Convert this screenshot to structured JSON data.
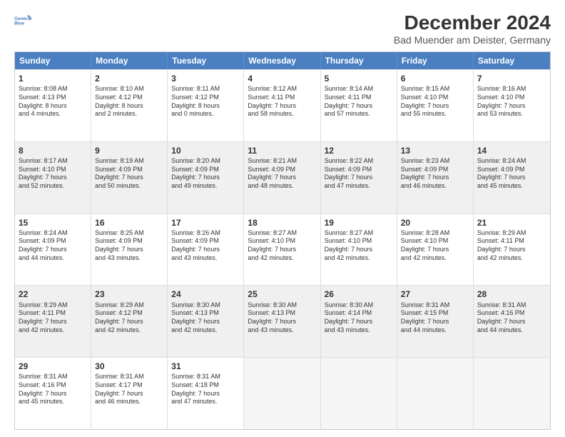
{
  "header": {
    "logo_line1": "General",
    "logo_line2": "Blue",
    "title": "December 2024",
    "subtitle": "Bad Muender am Deister, Germany"
  },
  "calendar": {
    "days": [
      "Sunday",
      "Monday",
      "Tuesday",
      "Wednesday",
      "Thursday",
      "Friday",
      "Saturday"
    ],
    "rows": [
      [
        {
          "day": "1",
          "lines": [
            "Sunrise: 8:08 AM",
            "Sunset: 4:13 PM",
            "Daylight: 8 hours",
            "and 4 minutes."
          ]
        },
        {
          "day": "2",
          "lines": [
            "Sunrise: 8:10 AM",
            "Sunset: 4:12 PM",
            "Daylight: 8 hours",
            "and 2 minutes."
          ]
        },
        {
          "day": "3",
          "lines": [
            "Sunrise: 8:11 AM",
            "Sunset: 4:12 PM",
            "Daylight: 8 hours",
            "and 0 minutes."
          ]
        },
        {
          "day": "4",
          "lines": [
            "Sunrise: 8:12 AM",
            "Sunset: 4:11 PM",
            "Daylight: 7 hours",
            "and 58 minutes."
          ]
        },
        {
          "day": "5",
          "lines": [
            "Sunrise: 8:14 AM",
            "Sunset: 4:11 PM",
            "Daylight: 7 hours",
            "and 57 minutes."
          ]
        },
        {
          "day": "6",
          "lines": [
            "Sunrise: 8:15 AM",
            "Sunset: 4:10 PM",
            "Daylight: 7 hours",
            "and 55 minutes."
          ]
        },
        {
          "day": "7",
          "lines": [
            "Sunrise: 8:16 AM",
            "Sunset: 4:10 PM",
            "Daylight: 7 hours",
            "and 53 minutes."
          ]
        }
      ],
      [
        {
          "day": "8",
          "lines": [
            "Sunrise: 8:17 AM",
            "Sunset: 4:10 PM",
            "Daylight: 7 hours",
            "and 52 minutes."
          ]
        },
        {
          "day": "9",
          "lines": [
            "Sunrise: 8:19 AM",
            "Sunset: 4:09 PM",
            "Daylight: 7 hours",
            "and 50 minutes."
          ]
        },
        {
          "day": "10",
          "lines": [
            "Sunrise: 8:20 AM",
            "Sunset: 4:09 PM",
            "Daylight: 7 hours",
            "and 49 minutes."
          ]
        },
        {
          "day": "11",
          "lines": [
            "Sunrise: 8:21 AM",
            "Sunset: 4:09 PM",
            "Daylight: 7 hours",
            "and 48 minutes."
          ]
        },
        {
          "day": "12",
          "lines": [
            "Sunrise: 8:22 AM",
            "Sunset: 4:09 PM",
            "Daylight: 7 hours",
            "and 47 minutes."
          ]
        },
        {
          "day": "13",
          "lines": [
            "Sunrise: 8:23 AM",
            "Sunset: 4:09 PM",
            "Daylight: 7 hours",
            "and 46 minutes."
          ]
        },
        {
          "day": "14",
          "lines": [
            "Sunrise: 8:24 AM",
            "Sunset: 4:09 PM",
            "Daylight: 7 hours",
            "and 45 minutes."
          ]
        }
      ],
      [
        {
          "day": "15",
          "lines": [
            "Sunrise: 8:24 AM",
            "Sunset: 4:09 PM",
            "Daylight: 7 hours",
            "and 44 minutes."
          ]
        },
        {
          "day": "16",
          "lines": [
            "Sunrise: 8:25 AM",
            "Sunset: 4:09 PM",
            "Daylight: 7 hours",
            "and 43 minutes."
          ]
        },
        {
          "day": "17",
          "lines": [
            "Sunrise: 8:26 AM",
            "Sunset: 4:09 PM",
            "Daylight: 7 hours",
            "and 43 minutes."
          ]
        },
        {
          "day": "18",
          "lines": [
            "Sunrise: 8:27 AM",
            "Sunset: 4:10 PM",
            "Daylight: 7 hours",
            "and 42 minutes."
          ]
        },
        {
          "day": "19",
          "lines": [
            "Sunrise: 8:27 AM",
            "Sunset: 4:10 PM",
            "Daylight: 7 hours",
            "and 42 minutes."
          ]
        },
        {
          "day": "20",
          "lines": [
            "Sunrise: 8:28 AM",
            "Sunset: 4:10 PM",
            "Daylight: 7 hours",
            "and 42 minutes."
          ]
        },
        {
          "day": "21",
          "lines": [
            "Sunrise: 8:29 AM",
            "Sunset: 4:11 PM",
            "Daylight: 7 hours",
            "and 42 minutes."
          ]
        }
      ],
      [
        {
          "day": "22",
          "lines": [
            "Sunrise: 8:29 AM",
            "Sunset: 4:11 PM",
            "Daylight: 7 hours",
            "and 42 minutes."
          ]
        },
        {
          "day": "23",
          "lines": [
            "Sunrise: 8:29 AM",
            "Sunset: 4:12 PM",
            "Daylight: 7 hours",
            "and 42 minutes."
          ]
        },
        {
          "day": "24",
          "lines": [
            "Sunrise: 8:30 AM",
            "Sunset: 4:13 PM",
            "Daylight: 7 hours",
            "and 42 minutes."
          ]
        },
        {
          "day": "25",
          "lines": [
            "Sunrise: 8:30 AM",
            "Sunset: 4:13 PM",
            "Daylight: 7 hours",
            "and 43 minutes."
          ]
        },
        {
          "day": "26",
          "lines": [
            "Sunrise: 8:30 AM",
            "Sunset: 4:14 PM",
            "Daylight: 7 hours",
            "and 43 minutes."
          ]
        },
        {
          "day": "27",
          "lines": [
            "Sunrise: 8:31 AM",
            "Sunset: 4:15 PM",
            "Daylight: 7 hours",
            "and 44 minutes."
          ]
        },
        {
          "day": "28",
          "lines": [
            "Sunrise: 8:31 AM",
            "Sunset: 4:16 PM",
            "Daylight: 7 hours",
            "and 44 minutes."
          ]
        }
      ],
      [
        {
          "day": "29",
          "lines": [
            "Sunrise: 8:31 AM",
            "Sunset: 4:16 PM",
            "Daylight: 7 hours",
            "and 45 minutes."
          ]
        },
        {
          "day": "30",
          "lines": [
            "Sunrise: 8:31 AM",
            "Sunset: 4:17 PM",
            "Daylight: 7 hours",
            "and 46 minutes."
          ]
        },
        {
          "day": "31",
          "lines": [
            "Sunrise: 8:31 AM",
            "Sunset: 4:18 PM",
            "Daylight: 7 hours",
            "and 47 minutes."
          ]
        },
        {
          "day": "",
          "lines": []
        },
        {
          "day": "",
          "lines": []
        },
        {
          "day": "",
          "lines": []
        },
        {
          "day": "",
          "lines": []
        }
      ]
    ]
  }
}
